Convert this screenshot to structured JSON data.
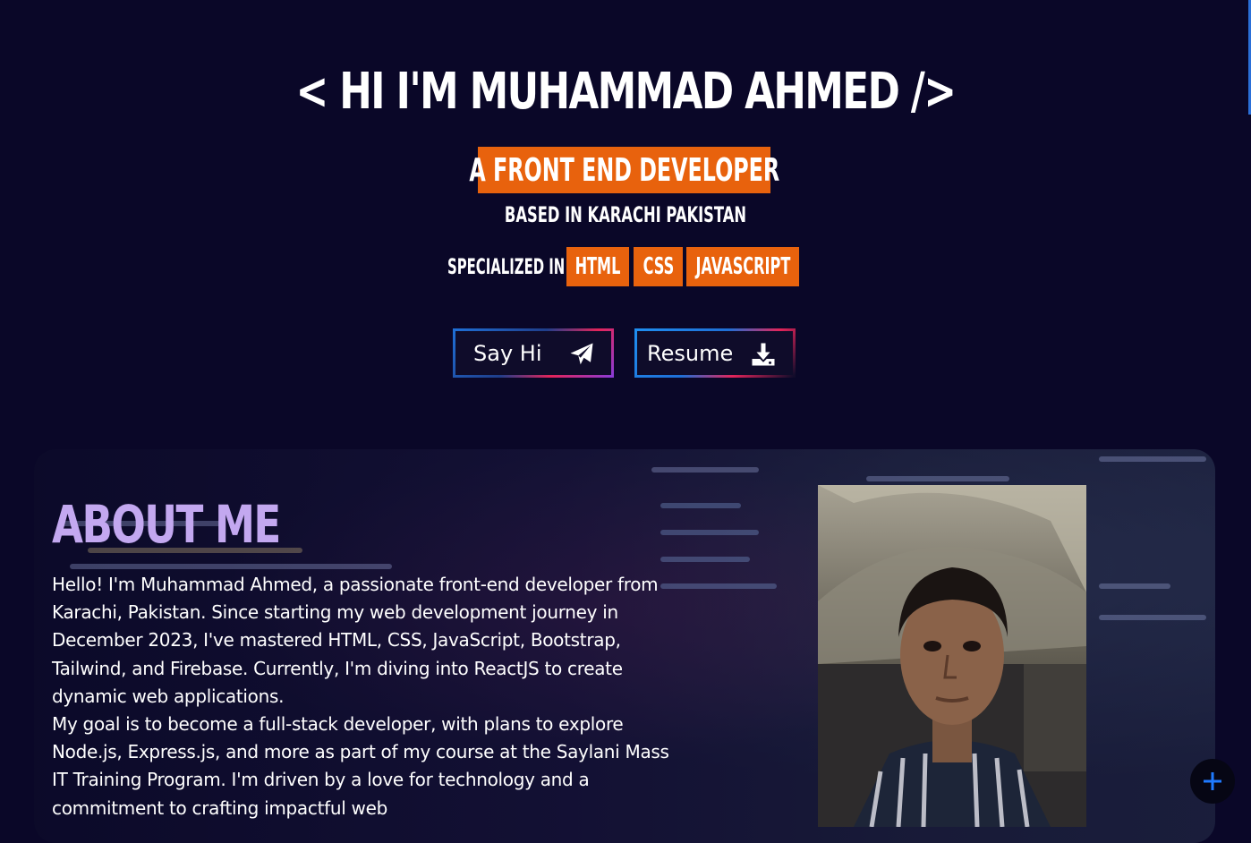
{
  "hero": {
    "title": "< HI I'M MUHAMMAD AHMED />",
    "role": "A FRONT END DEVELOPER",
    "based": "BASED IN KARACHI PAKISTAN",
    "specialized_label": "SPECIALIZED IN",
    "skills": [
      "HTML",
      "CSS",
      "JAVASCRIPT"
    ]
  },
  "buttons": {
    "say_hi": "Say Hi",
    "resume": "Resume"
  },
  "about": {
    "title": "ABOUT ME",
    "paragraph1": "Hello! I'm Muhammad Ahmed, a passionate front-end developer from Karachi, Pakistan. Since starting my web development journey in December 2023, I've mastered HTML, CSS, JavaScript, Bootstrap, Tailwind, and Firebase. Currently, I'm diving into ReactJS to create dynamic web applications.",
    "paragraph2": "My goal is to become a full-stack developer, with plans to explore Node.js, Express.js, and more as part of my course at the Saylani Mass IT Training Program. I'm driven by a love for technology and a commitment to crafting impactful web"
  },
  "colors": {
    "background": "#0a0728",
    "accent": "#e8620d",
    "about_title": "#c3a8f0",
    "fab_plus": "#1f7aff"
  },
  "icons": {
    "say_hi": "paper-plane-icon",
    "resume": "download-icon",
    "fab": "plus-icon"
  }
}
